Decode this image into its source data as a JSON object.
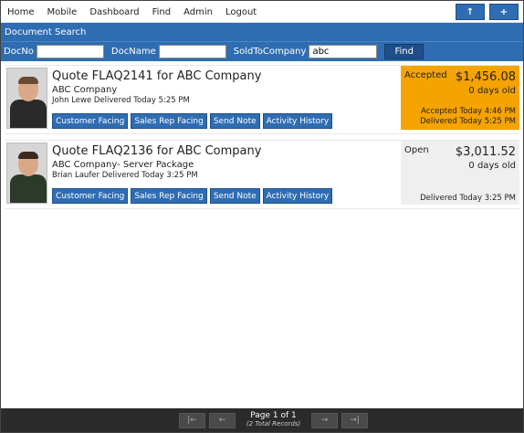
{
  "nav": {
    "links": [
      "Home",
      "Mobile",
      "Dashboard",
      "Find",
      "Admin",
      "Logout"
    ],
    "action_up": "↑",
    "action_add": "+"
  },
  "section_title": "Document Search",
  "filters": {
    "docno_label": "DocNo",
    "docno_value": "",
    "docname_label": "DocName",
    "docname_value": "",
    "soldto_label": "SoldToCompany",
    "soldto_value": "abc",
    "find_label": "Find"
  },
  "buttons": {
    "customer_facing": "Customer Facing",
    "sales_rep_facing": "Sales Rep Facing",
    "send_note": "Send Note",
    "activity_history": "Activity History"
  },
  "quotes": [
    {
      "title": "Quote FLAQ2141 for ABC Company",
      "company": "ABC Company",
      "delivered_by": "John Lewe Delivered Today 5:25 PM",
      "status": "Accepted",
      "amount": "$1,456.08",
      "age": "0 days old",
      "line1": "Accepted Today 4:46 PM",
      "line2": "Delivered Today 5:25 PM",
      "status_color": "#f5a300"
    },
    {
      "title": "Quote FLAQ2136 for ABC Company",
      "company": "ABC Company- Server Package",
      "delivered_by": "Brian Laufer Delivered Today 3:25 PM",
      "status": "Open",
      "amount": "$3,011.52",
      "age": "0 days old",
      "line1": "Delivered Today 3:25 PM",
      "status_color": "#efefef"
    }
  ],
  "pager": {
    "first": "|←",
    "prev": "←",
    "page_text": "Page 1 of 1",
    "records_text": "(2 Total Records)",
    "next": "→",
    "last": "→|"
  }
}
